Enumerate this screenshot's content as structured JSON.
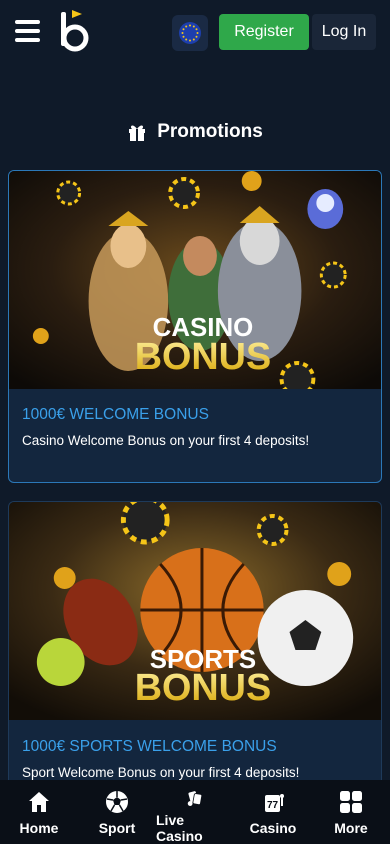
{
  "header": {
    "register_label": "Register",
    "login_label": "Log In"
  },
  "page": {
    "title": "Promotions",
    "title_icon": "gift-icon"
  },
  "promotions": [
    {
      "banner_line1": "CASINO",
      "banner_line2": "BONUS",
      "title": "1000€ WELCOME BONUS",
      "description": "Casino Welcome Bonus on your first 4 deposits!"
    },
    {
      "banner_line1": "SPORTS",
      "banner_line2": "BONUS",
      "title": "1000€ SPORTS WELCOME BONUS",
      "description": "Sport Welcome Bonus on your first 4 deposits!"
    }
  ],
  "bottom_nav": {
    "items": [
      {
        "label": "Home",
        "icon": "home-icon"
      },
      {
        "label": "Sport",
        "icon": "soccer-ball-icon"
      },
      {
        "label": "Live Casino",
        "icon": "cards-icon"
      },
      {
        "label": "Casino",
        "icon": "slot-machine-icon"
      },
      {
        "label": "More",
        "icon": "grid-icon"
      }
    ]
  },
  "colors": {
    "background": "#0f1a29",
    "accent_green": "#2fa84a",
    "link_blue": "#3aa0ea",
    "gold": "#f5c518"
  }
}
